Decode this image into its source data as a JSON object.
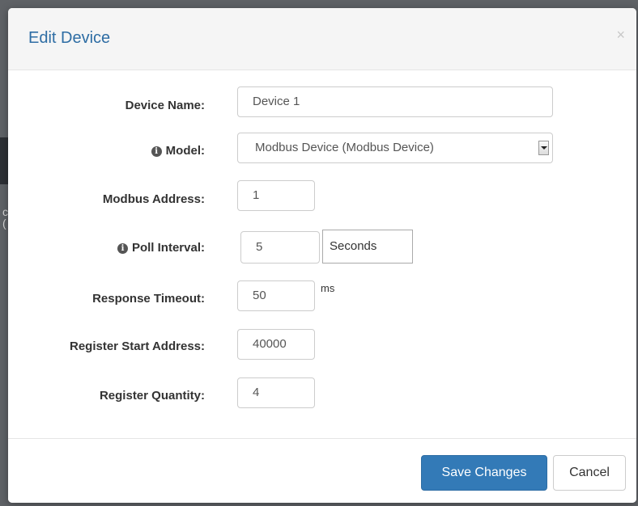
{
  "modal": {
    "title": "Edit Device",
    "close_glyph": "×"
  },
  "form": {
    "device_name": {
      "label": "Device Name:",
      "value": "Device 1"
    },
    "model": {
      "label": "Model:",
      "value": "Modbus Device (Modbus Device)",
      "info_icon": "info-circle-icon"
    },
    "modbus_address": {
      "label": "Modbus Address:",
      "value": "1"
    },
    "poll_interval": {
      "label": "Poll Interval:",
      "value": "5",
      "unit": "Seconds",
      "info_icon": "info-circle-icon"
    },
    "response_timeout": {
      "label": "Response Timeout:",
      "value": "50",
      "unit": "ms"
    },
    "register_start_address": {
      "label": "Register Start Address:",
      "value": "40000"
    },
    "register_quantity": {
      "label": "Register Quantity:",
      "value": "4"
    }
  },
  "footer": {
    "save_label": "Save Changes",
    "cancel_label": "Cancel"
  },
  "colors": {
    "title": "#2e6da4",
    "primary_button": "#337ab7",
    "header_background": "#f5f5f5"
  }
}
